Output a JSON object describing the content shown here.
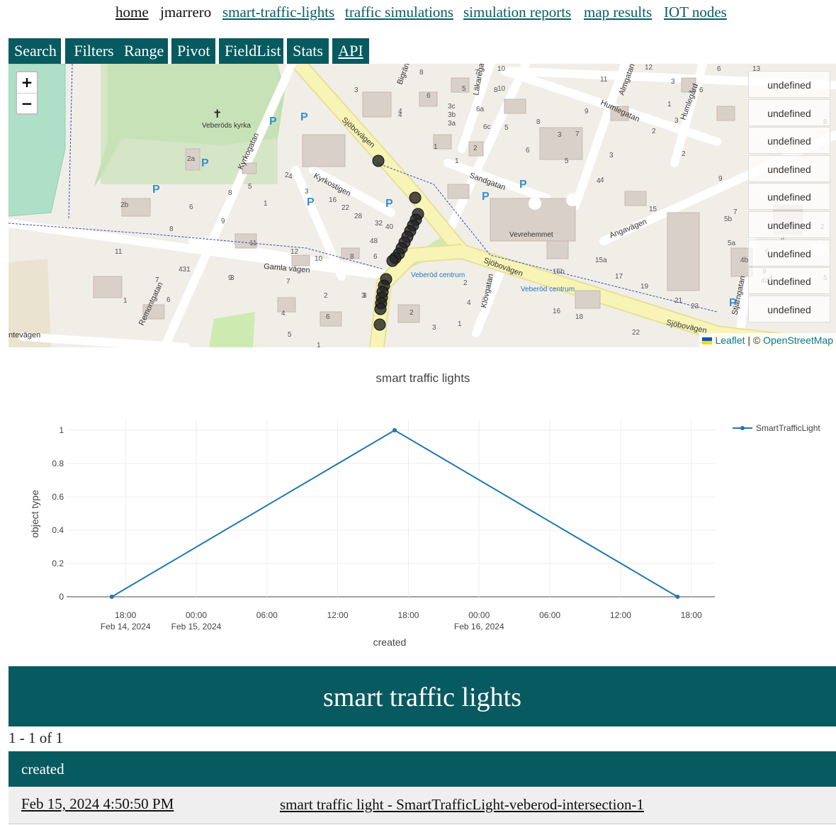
{
  "topnav": {
    "home": "home",
    "user": "jmarrero",
    "links": [
      "smart-traffic-lights",
      "traffic simulations",
      "simulation reports",
      "map results",
      "IOT nodes"
    ]
  },
  "toolbar": {
    "buttons": [
      "Search",
      "Filters",
      "Range",
      "Pivot",
      "FieldList",
      "Stats",
      "API"
    ]
  },
  "map": {
    "zoom_in": "+",
    "zoom_out": "−",
    "legend_items": [
      "undefined",
      "undefined",
      "undefined",
      "undefined",
      "undefined",
      "undefined",
      "undefined",
      "undefined",
      "undefined"
    ],
    "attribution_leaflet": "Leaflet",
    "attribution_sep": " | © ",
    "attribution_osm": "OpenStreetMap",
    "labels": {
      "church": "Veberöds kyrka",
      "home": "Vevrehemmet",
      "stop1": "Veberöd centrum",
      "stop2": "Veberöd centrum",
      "sjobovagen_1": "Sjöbovägen",
      "sjobovagen_2": "Sjöbovägen",
      "sjobovagen_3": "Sjöbovägen",
      "gamla": "Gamla vägen",
      "kyrkostigen": "Kyrkostigen",
      "kyrkogatan": "Kyrkogatan",
      "sandgatan": "Sandgatan",
      "angavagen": "Angavägen",
      "humlegatan": "Humlegatan",
      "humlegard": "Humlegård",
      "almgatan": "Almgatan",
      "lakaregatan": "Läkaregatan",
      "klovgatan": "Klövgatan",
      "remontgatan": "Remontgatan",
      "stjarngatan": "Stjärngatan",
      "bigrand": "Bigränd",
      "tevagen": "ntevägen"
    },
    "house_numbers": [
      "13",
      "6",
      "10",
      "12",
      "3",
      "8",
      "7",
      "10",
      "11",
      "6",
      "4",
      "3",
      "5",
      "8",
      "6",
      "9",
      "3",
      "1",
      "1",
      "4",
      "2",
      "3c",
      "3b",
      "3a",
      "6a",
      "6c",
      "5",
      "8",
      "7",
      "6",
      "5",
      "4",
      "2",
      "3",
      "1",
      "2a",
      "2b",
      "5",
      "6",
      "4",
      "3",
      "2",
      "1",
      "9",
      "8",
      "16",
      "22",
      "28",
      "32",
      "40",
      "48",
      "6",
      "8",
      "10",
      "12",
      "11",
      "9",
      "7",
      "2",
      "3",
      "3",
      "4",
      "6",
      "5",
      "1",
      "2",
      "4",
      "3",
      "1",
      "2",
      "16",
      "18",
      "21",
      "22",
      "23",
      "15a",
      "15b",
      "17",
      "19",
      "5b",
      "5a",
      "4b",
      "4d",
      "4",
      "5",
      "3",
      "2",
      "7",
      "9",
      "6",
      "4",
      "5",
      "4",
      "3",
      "2",
      "8",
      "9",
      "15",
      "431",
      "11",
      "1",
      "3",
      "7",
      "6",
      "8"
    ]
  },
  "chart_data": {
    "type": "line",
    "title": "smart traffic lights",
    "xlabel": "created",
    "ylabel": "object type",
    "ylim": [
      0,
      1
    ],
    "yticks": [
      "0",
      "0.2",
      "0.4",
      "0.6",
      "0.8",
      "1"
    ],
    "xticks": [
      {
        "time": "18:00",
        "date": "Feb 14, 2024"
      },
      {
        "time": "00:00",
        "date": "Feb 15, 2024"
      },
      {
        "time": "06:00",
        "date": ""
      },
      {
        "time": "12:00",
        "date": ""
      },
      {
        "time": "18:00",
        "date": ""
      },
      {
        "time": "00:00",
        "date": "Feb 16, 2024"
      },
      {
        "time": "06:00",
        "date": ""
      },
      {
        "time": "12:00",
        "date": ""
      },
      {
        "time": "18:00",
        "date": ""
      }
    ],
    "xlim": [
      "2024-02-14T13:00",
      "2024-02-16T20:00"
    ],
    "series": [
      {
        "name": "SmartTrafficLight",
        "color": "#1f77b4",
        "x": [
          "2024-02-14T16:50",
          "2024-02-15T16:50",
          "2024-02-16T16:50"
        ],
        "y": [
          0,
          1,
          0
        ]
      }
    ],
    "legend": "top-right"
  },
  "section_title": "smart traffic lights",
  "pager": "1 - 1 of 1",
  "table": {
    "header": "created",
    "rows": [
      {
        "created": "Feb 15, 2024 4:50:50 PM",
        "name": "smart traffic light - SmartTrafficLight-veberod-intersection-1"
      }
    ]
  }
}
